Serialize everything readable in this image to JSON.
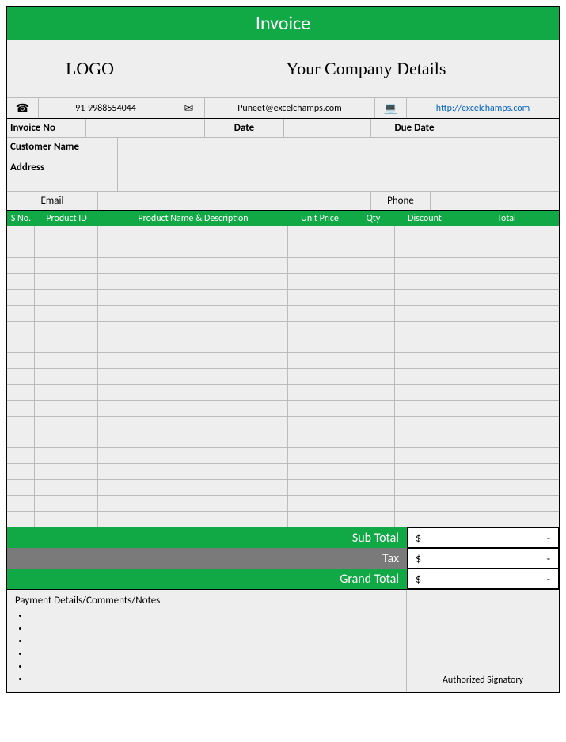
{
  "title": "Invoice",
  "logo_text": "LOGO",
  "company_details": "Your Company Details",
  "contact": {
    "phone": "91-9988554044",
    "email": "Puneet@excelchamps.com",
    "website": "http://excelchamps.com"
  },
  "labels": {
    "invoice_no": "Invoice No",
    "date": "Date",
    "due_date": "Due Date",
    "customer_name": "Customer Name",
    "address": "Address",
    "email": "Email",
    "phone": "Phone"
  },
  "fields": {
    "invoice_no": "",
    "date": "",
    "due_date": "",
    "customer_name": "",
    "address": "",
    "email": "",
    "phone": ""
  },
  "columns": {
    "sno": "S No.",
    "product_id": "Product ID",
    "product_name": "Product Name & Description",
    "unit_price": "Unit Price",
    "qty": "Qty",
    "discount": "Discount",
    "total": "Total"
  },
  "items_row_count": 19,
  "totals": {
    "subtotal_label": "Sub Total",
    "tax_label": "Tax",
    "grand_total_label": "Grand Total",
    "currency": "$",
    "subtotal_value": "-",
    "tax_value": "-",
    "grand_total_value": "-"
  },
  "notes": {
    "heading": "Payment Details/Comments/Notes",
    "bullets": [
      "",
      "",
      "",
      "",
      "",
      ""
    ]
  },
  "signatory_label": "Authorized Signatory"
}
